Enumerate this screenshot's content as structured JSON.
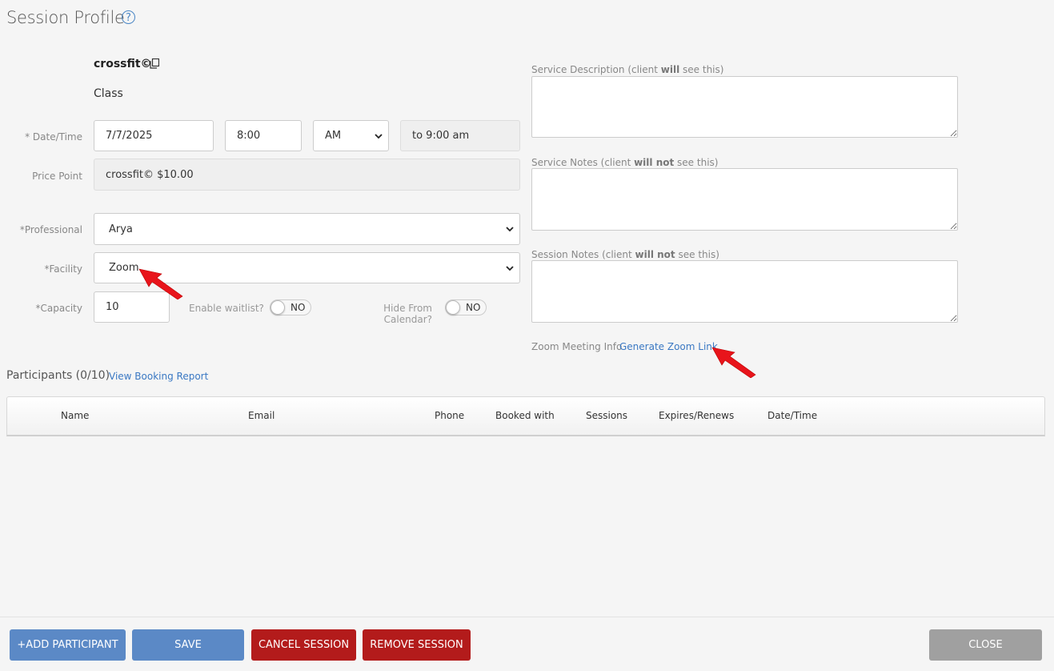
{
  "header": {
    "title": "Session Profile",
    "help_icon": "?"
  },
  "service": {
    "name": "crossfit©",
    "type": "Class"
  },
  "labels": {
    "datetime": "* Date/Time",
    "price_point": "Price Point",
    "professional": "*Professional",
    "facility": "*Facility",
    "capacity": "*Capacity",
    "enable_waitlist": "Enable waitlist?",
    "hide_from_calendar": "Hide From Calendar?"
  },
  "fields": {
    "date": "7/7/2025",
    "time": "8:00",
    "ampm": "AM",
    "end_time": "to 9:00 am",
    "price_point": "crossfit© $10.00",
    "professional": "Arya",
    "facility": "Zoom",
    "capacity": "10",
    "waitlist_toggle": "NO",
    "hide_toggle": "NO"
  },
  "right_panel": {
    "service_description_prefix": "Service Description (client ",
    "service_description_bold": "will",
    "service_description_suffix": " see this)",
    "service_notes_prefix": "Service Notes (client ",
    "service_notes_bold": "will not",
    "service_notes_suffix": " see this)",
    "session_notes_prefix": "Session Notes (client ",
    "session_notes_bold": "will not",
    "session_notes_suffix": " see this)",
    "zoom_label": "Zoom Meeting Info",
    "zoom_link": "Generate Zoom Link"
  },
  "participants": {
    "label": "Participants (0/10)",
    "report_link": "View Booking Report",
    "columns": [
      "Name",
      "Email",
      "Phone",
      "Booked with",
      "Sessions",
      "Expires/Renews",
      "Date/Time"
    ]
  },
  "footer": {
    "add_participant": "+ADD PARTICIPANT",
    "save": "SAVE",
    "cancel_session": "CANCEL SESSION",
    "remove_session": "REMOVE SESSION",
    "close": "CLOSE"
  },
  "colors": {
    "link_blue": "#3a78c3",
    "button_blue": "#5b89c6",
    "button_red": "#b31b1b",
    "button_grey": "#a0a0a0",
    "annotation_arrow": "#e8141b"
  }
}
